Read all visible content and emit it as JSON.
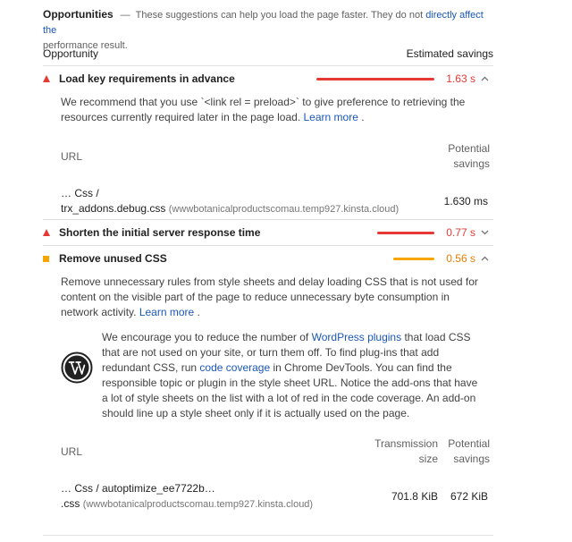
{
  "section": {
    "title": "Opportunities",
    "dash": "—",
    "desc_prefix": "These suggestions can help you load the page faster. They do not",
    "desc_link": "directly affect the",
    "desc_suffix": "performance result."
  },
  "columns": {
    "opportunity": "Opportunity",
    "savings": "Estimated savings"
  },
  "audits": [
    {
      "name": "Load key requirements in advance",
      "saving": "1.63 s",
      "status": "fail",
      "expanded": true,
      "description": "We recommend that you use `<link rel = preload>` to give preference to retrieving the resources currently required later in the page load.",
      "learn_more": "Learn more",
      "table": {
        "col_url": "URL",
        "col_potential_1": "Potential",
        "col_potential_2": "savings",
        "rows": [
          {
            "path_1": "… Css /",
            "path_2": "trx_addons.debug.css",
            "host": "(wwwbotanicalproductscomau.temp927.kinsta.cloud)",
            "savings": "1.630 ms"
          }
        ]
      }
    },
    {
      "name": "Shorten the initial server response time",
      "saving": "0.77 s",
      "status": "fail",
      "expanded": false
    },
    {
      "name": "Remove unused CSS",
      "saving": "0.56 s",
      "status": "average",
      "expanded": true,
      "description": "Remove unnecessary rules from style sheets and delay loading CSS that is not used for content on the visible part of the page to reduce unnecessary byte consumption in network activity.",
      "learn_more": "Learn more",
      "wp": {
        "t1": "We encourage you to reduce the number of",
        "l1": "WordPress plugins",
        "t2": "that load CSS that are not used on your site, or turn them off. To find plug-ins that add redundant CSS, run",
        "l2": "code coverage",
        "t3": "in Chrome DevTools. You can find the responsible topic or plugin in the style sheet URL. Notice the add-ons that have a lot of style sheets on the list with a lot of red in the code coverage. An add-on should line up a style sheet only if it is actually used on the page."
      },
      "table": {
        "col_url": "URL",
        "col_transmission_1": "Transmission",
        "col_transmission_2": "size",
        "col_potential_1": "Potential",
        "col_potential_2": "savings",
        "rows": [
          {
            "path_1": "… Css / autoptimize_ee7722b…",
            "path_2": ".css",
            "host": "(wwwbotanicalproductscomau.temp927.kinsta.cloud)",
            "size": "701.8 KiB",
            "savings": "672 KiB"
          }
        ]
      }
    }
  ],
  "colors": {
    "fail": "#e53935",
    "average": "#f7a600",
    "link": "#1a57b8"
  }
}
